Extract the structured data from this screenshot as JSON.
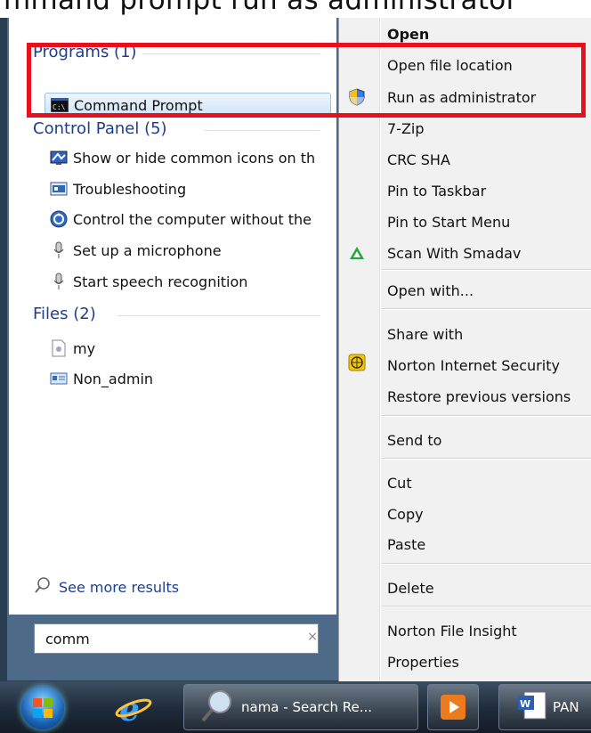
{
  "caption": "mmand prompt run as administrator",
  "start_menu": {
    "programs_header": "Programs (1)",
    "programs": [
      {
        "label": "Command Prompt",
        "icon": "cmd-icon"
      }
    ],
    "control_panel_header": "Control Panel (5)",
    "control_panel": [
      {
        "label": "Show or hide common icons on th",
        "icon": "desktop-icons-icon"
      },
      {
        "label": "Troubleshooting",
        "icon": "troubleshooting-icon"
      },
      {
        "label": "Control the computer without the",
        "icon": "ease-of-access-icon"
      },
      {
        "label": "Set up a microphone",
        "icon": "microphone-icon"
      },
      {
        "label": "Start speech recognition",
        "icon": "microphone-icon"
      }
    ],
    "files_header": "Files (2)",
    "files": [
      {
        "label": "my",
        "icon": "file-icon"
      },
      {
        "label": "Non_admin",
        "icon": "shortcut-icon"
      }
    ],
    "see_more": "See more results",
    "search_value": "comm",
    "search_clear": "×"
  },
  "context_menu": {
    "items": [
      {
        "label": "Open",
        "bold": true
      },
      {
        "label": "Open file location"
      },
      {
        "label": "Run as administrator",
        "icon": "uac-shield-icon"
      },
      {
        "label": "7-Zip"
      },
      {
        "label": "CRC SHA"
      },
      {
        "label": "Pin to Taskbar"
      },
      {
        "label": "Pin to Start Menu"
      },
      {
        "label": "Scan With Smadav",
        "icon": "smadav-icon"
      },
      {
        "label": "Open with..."
      },
      {
        "label": "Share with"
      },
      {
        "label": "Norton Internet Security",
        "icon": "norton-icon"
      },
      {
        "label": "Restore previous versions"
      },
      {
        "label": "Send to"
      },
      {
        "label": "Cut"
      },
      {
        "label": "Copy"
      },
      {
        "label": "Paste"
      },
      {
        "label": "Delete"
      },
      {
        "label": "Norton File Insight"
      },
      {
        "label": "Properties"
      }
    ]
  },
  "taskbar": {
    "search_window": "nama - Search Re...",
    "word_window": "PAN"
  }
}
